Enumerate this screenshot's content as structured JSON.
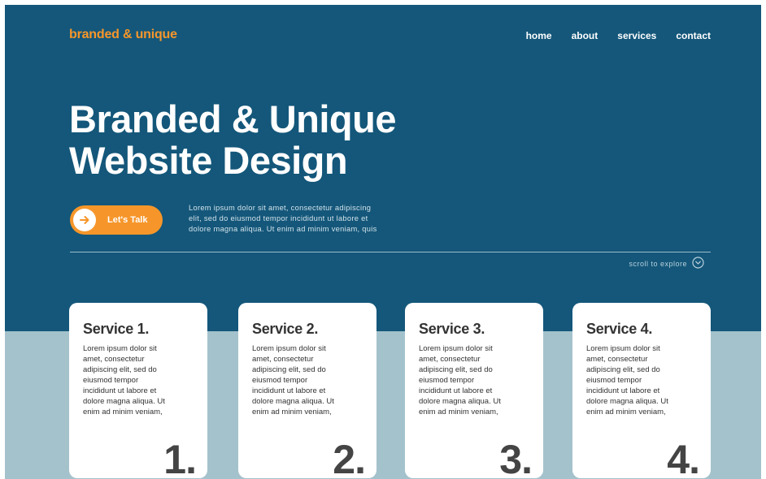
{
  "header": {
    "logo": "branded & unique",
    "nav": [
      "home",
      "about",
      "services",
      "contact"
    ]
  },
  "hero": {
    "headline_line1": "Branded & Unique",
    "headline_line2": "Website Design",
    "cta_label": "Let's Talk",
    "cta_icon": "arrow-right-icon",
    "intro_line1": "Lorem ipsum dolor sit amet, consectetur adipiscing",
    "intro_line2": "elit, sed do eiusmod tempor incididunt ut labore et",
    "intro_line3": "dolore magna aliqua. Ut enim ad minim veniam, quis",
    "scroll_label": "scroll to explore",
    "scroll_icon": "chevron-down-circle-icon"
  },
  "services": [
    {
      "title": "Service 1.",
      "number": "1.",
      "lines": [
        "Lorem ipsum dolor sit",
        "amet, consectetur",
        "adipiscing elit, sed do",
        "eiusmod tempor",
        "incididunt ut labore et",
        "dolore magna aliqua. Ut",
        "enim ad minim veniam,"
      ]
    },
    {
      "title": "Service 2.",
      "number": "2.",
      "lines": [
        "Lorem ipsum dolor sit",
        "amet, consectetur",
        "adipiscing elit, sed do",
        "eiusmod tempor",
        "incididunt ut labore et",
        "dolore magna aliqua. Ut",
        "enim ad minim veniam,"
      ]
    },
    {
      "title": "Service 3.",
      "number": "3.",
      "lines": [
        "Lorem ipsum dolor sit",
        "amet, consectetur",
        "adipiscing elit, sed do",
        "eiusmod tempor",
        "incididunt ut labore et",
        "dolore magna aliqua. Ut",
        "enim ad minim veniam,"
      ]
    },
    {
      "title": "Service 4.",
      "number": "4.",
      "lines": [
        "Lorem ipsum dolor sit",
        "amet, consectetur",
        "adipiscing elit, sed do",
        "eiusmod tempor",
        "incididunt ut labore et",
        "dolore magna aliqua. Ut",
        "enim ad minim veniam,"
      ]
    }
  ],
  "colors": {
    "hero_background": "#14577a",
    "lower_background": "#a4c2cc",
    "accent": "#f6962a",
    "card_background": "#ffffff",
    "card_text": "#333333"
  }
}
